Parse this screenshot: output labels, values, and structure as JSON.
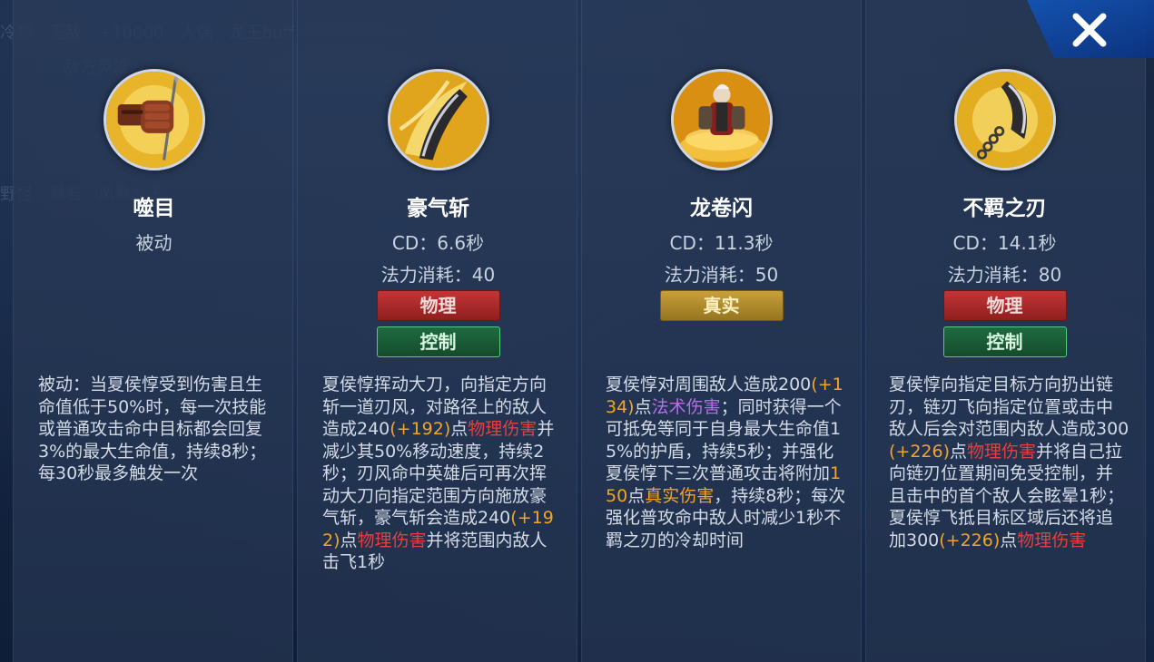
{
  "skills": [
    {
      "name": "噬目",
      "passive_label": "被动",
      "icon": "gauntlet-fist-icon",
      "description": [
        {
          "t": "被动：当夏侯惇受到伤害且生命值低于50%时，每一次技能或普通攻击命中目标都会回复3%的最大生命值，持续8秒；每30秒最多触发一次",
          "c": ""
        }
      ]
    },
    {
      "name": "豪气斩",
      "cd": "CD：6.6秒",
      "mana": "法力消耗：40",
      "tags": [
        {
          "label": "物理",
          "type": "phys"
        },
        {
          "label": "控制",
          "type": "ctrl"
        }
      ],
      "icon": "blade-slash-icon",
      "description": [
        {
          "t": "夏侯惇挥动大刀，向指定方向斩一道刃风，对路径上的敌人造成240",
          "c": ""
        },
        {
          "t": "(+192)",
          "c": "o"
        },
        {
          "t": "点",
          "c": ""
        },
        {
          "t": "物理伤害",
          "c": "r"
        },
        {
          "t": "并减少其50%移动速度，持续2秒；刃风命中英雄后可再次挥动大刀向指定范围方向施放豪气斩，豪气斩会造成240",
          "c": ""
        },
        {
          "t": "(+192)",
          "c": "o"
        },
        {
          "t": "点",
          "c": ""
        },
        {
          "t": "物理伤害",
          "c": "r"
        },
        {
          "t": "并将范围内敌人击飞1秒",
          "c": ""
        }
      ]
    },
    {
      "name": "龙卷闪",
      "cd": "CD：11.3秒",
      "mana": "法力消耗：50",
      "tags": [
        {
          "label": "真实",
          "type": "true"
        }
      ],
      "icon": "warrior-whirlwind-icon",
      "description": [
        {
          "t": "夏侯惇对周围敌人造成200",
          "c": ""
        },
        {
          "t": "(+134)",
          "c": "o"
        },
        {
          "t": "点",
          "c": ""
        },
        {
          "t": "法术伤害",
          "c": "p"
        },
        {
          "t": "；同时获得一个可抵免等同于自身最大生命值15%的护盾，持续5秒；并强化夏侯惇下三次普通攻击将附加",
          "c": ""
        },
        {
          "t": "150",
          "c": "o"
        },
        {
          "t": "点",
          "c": ""
        },
        {
          "t": "真实伤害",
          "c": "o"
        },
        {
          "t": "，持续8秒；每次强化普攻命中敌人时减少1秒不羁之刃的冷却时间",
          "c": ""
        }
      ]
    },
    {
      "name": "不羁之刃",
      "cd": "CD：14.1秒",
      "mana": "法力消耗：80",
      "tags": [
        {
          "label": "物理",
          "type": "phys"
        },
        {
          "label": "控制",
          "type": "ctrl"
        }
      ],
      "icon": "chain-blade-icon",
      "description": [
        {
          "t": "夏侯惇向指定目标方向扔出链刃，链刃飞向指定位置或击中敌人后会对范围内敌人造成300",
          "c": ""
        },
        {
          "t": "(+226)",
          "c": "o"
        },
        {
          "t": "点",
          "c": ""
        },
        {
          "t": "物理伤害",
          "c": "r"
        },
        {
          "t": "并将自己拉向链刃位置期间免受控制，并且击中的首个敌人会眩晕1秒；夏侯惇飞抵目标区域后还将追加300",
          "c": ""
        },
        {
          "t": "(+226)",
          "c": "o"
        },
        {
          "t": "点",
          "c": ""
        },
        {
          "t": "物理伤害",
          "c": "r"
        }
      ]
    }
  ],
  "close_label": "close",
  "colors": {
    "bonus": "#f2a526",
    "physical": "#e4403f",
    "magic": "#b56ee8"
  }
}
